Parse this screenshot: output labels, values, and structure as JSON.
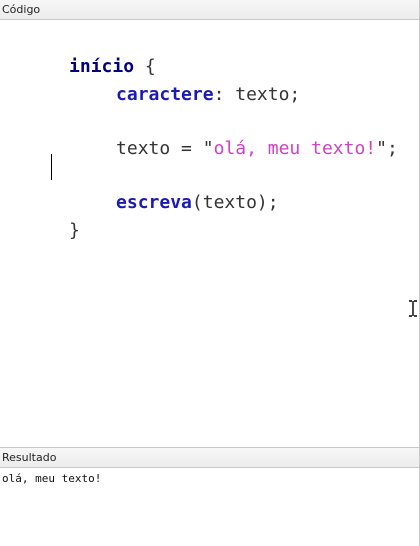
{
  "code_panel": {
    "title": "Código"
  },
  "editor": {
    "lines": [
      {
        "kw": "início",
        "rest": " {"
      },
      {
        "kw": "caractere",
        "rest": ": texto;"
      },
      {
        "before": "texto = \"",
        "str": "olá, meu texto!",
        "after": "\";"
      },
      {
        "kw": "escreva",
        "rest": "(texto);"
      },
      {
        "text": "}"
      }
    ]
  },
  "result_panel": {
    "title": "Resultado",
    "output": "olá, meu texto!"
  },
  "colors": {
    "keyword": "#1a1ab8",
    "string": "#d040c8",
    "text": "#333333"
  }
}
